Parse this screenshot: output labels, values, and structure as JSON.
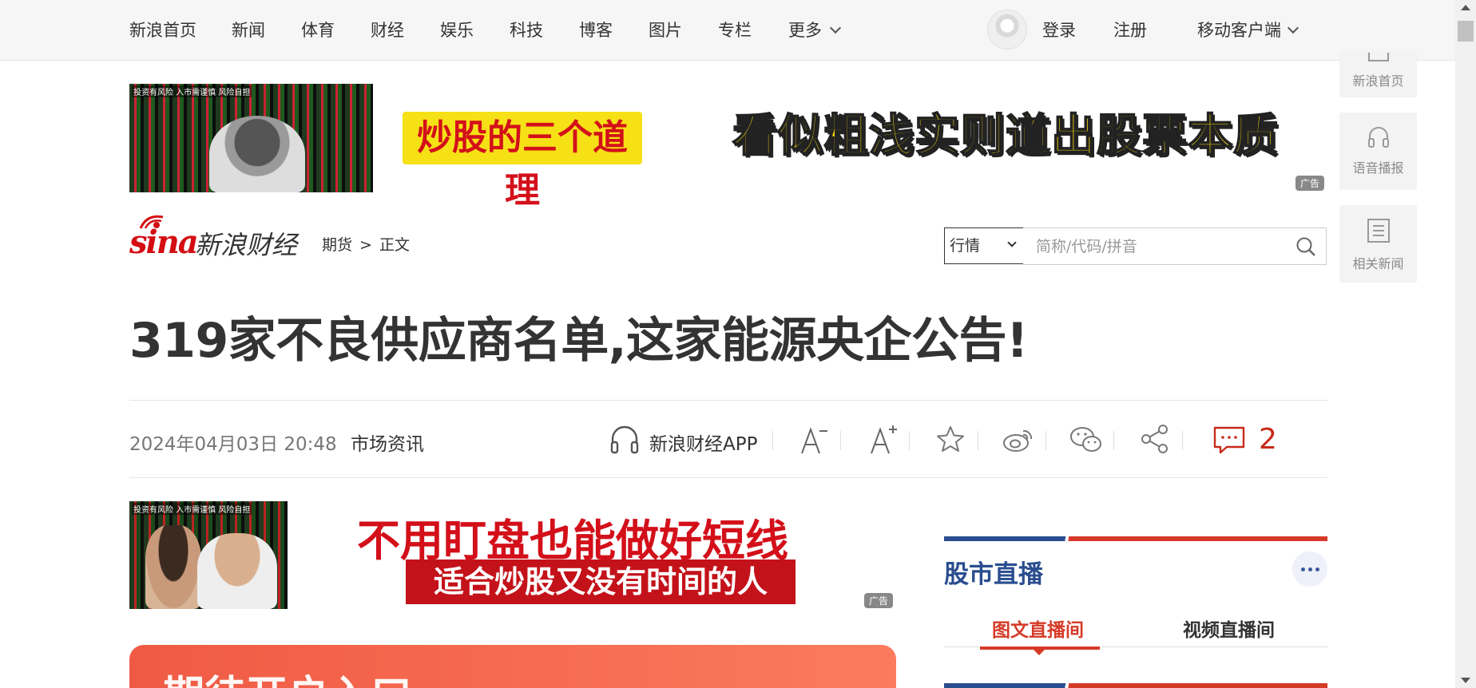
{
  "nav": {
    "items": [
      "新浪首页",
      "新闻",
      "体育",
      "财经",
      "娱乐",
      "科技",
      "博客",
      "图片",
      "专栏",
      "更多"
    ],
    "login": "登录",
    "register": "注册",
    "mobile": "移动客户端"
  },
  "ads": {
    "top": {
      "warning": "投资有风险 入市需谨慎 风险自担",
      "yellow": "炒股的三个道理",
      "slogan": "看似粗浅实则道出股票本质",
      "badge": "广告"
    },
    "second": {
      "warning": "投资有风险 入市需谨慎 风险自担",
      "line1": "不用盯盘也能做好短线",
      "line2": "适合炒股又没有时间的人",
      "badge": "广告"
    },
    "third": {
      "text": "期待开户入口"
    }
  },
  "logo": {
    "brand": "sina",
    "name": "新浪财经"
  },
  "breadcrumb": {
    "section": "期货",
    "sep": ">",
    "current": "正文"
  },
  "search": {
    "type": "行情",
    "placeholder": "简称/代码/拼音"
  },
  "side_tools": {
    "home": "新浪首页",
    "audio": "语音播报",
    "related": "相关新闻"
  },
  "article": {
    "title": "319家不良供应商名单,这家能源央企公告!",
    "date": "2024年04月03日 20:48",
    "source": "市场资讯",
    "app_label": "新浪财经APP",
    "comment_count": "2"
  },
  "stock_live": {
    "title": "股市直播",
    "tabs": [
      "图文直播间",
      "视频直播间"
    ]
  },
  "colors": {
    "accent_red": "#d53a27",
    "brand_blue": "#2a4d8f"
  }
}
